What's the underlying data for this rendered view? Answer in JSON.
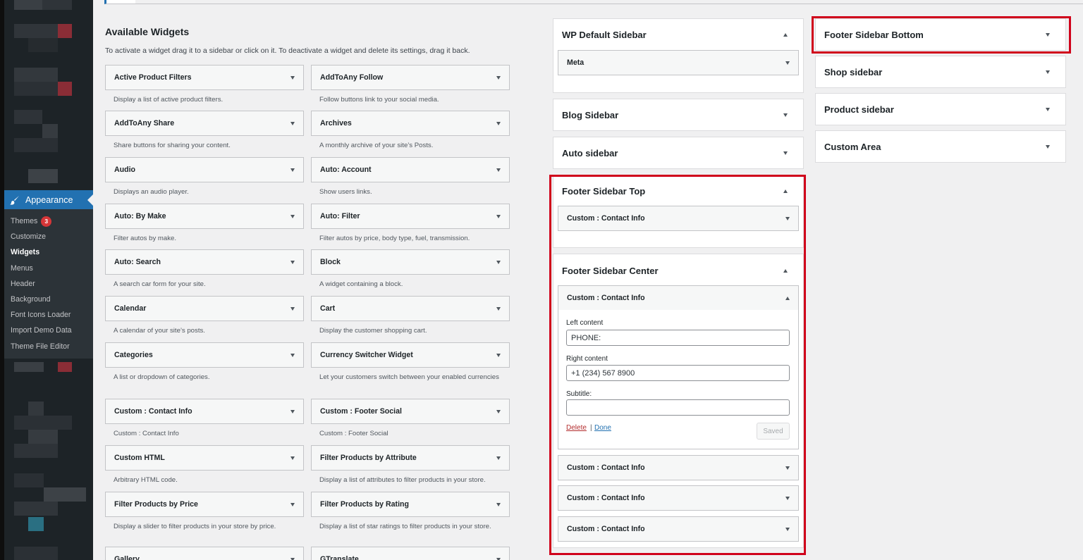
{
  "admin_menu": {
    "appearance_label": "Appearance",
    "submenu": [
      {
        "label": "Themes",
        "badge": "3"
      },
      {
        "label": "Customize"
      },
      {
        "label": "Widgets",
        "current": true
      },
      {
        "label": "Menus"
      },
      {
        "label": "Header"
      },
      {
        "label": "Background"
      },
      {
        "label": "Font Icons Loader"
      },
      {
        "label": "Import Demo Data"
      },
      {
        "label": "Theme File Editor"
      }
    ]
  },
  "available": {
    "title": "Available Widgets",
    "description": "To activate a widget drag it to a sidebar or click on it. To deactivate a widget and delete its settings, drag it back.",
    "widgets": [
      {
        "title": "Active Product Filters",
        "desc": "Display a list of active product filters."
      },
      {
        "title": "AddToAny Follow",
        "desc": "Follow buttons link to your social media."
      },
      {
        "title": "AddToAny Share",
        "desc": "Share buttons for sharing your content."
      },
      {
        "title": "Archives",
        "desc": "A monthly archive of your site’s Posts."
      },
      {
        "title": "Audio",
        "desc": "Displays an audio player."
      },
      {
        "title": "Auto: Account",
        "desc": "Show users links."
      },
      {
        "title": "Auto: By Make",
        "desc": "Filter autos by make."
      },
      {
        "title": "Auto: Filter",
        "desc": "Filter autos by price, body type, fuel, transmission."
      },
      {
        "title": "Auto: Search",
        "desc": "A search car form for your site."
      },
      {
        "title": "Block",
        "desc": "A widget containing a block."
      },
      {
        "title": "Calendar",
        "desc": "A calendar of your site’s posts."
      },
      {
        "title": "Cart",
        "desc": "Display the customer shopping cart."
      },
      {
        "title": "Categories",
        "desc": "A list or dropdown of categories."
      },
      {
        "title": "Currency Switcher Widget",
        "desc": "Let your customers switch between your enabled currencies"
      },
      {
        "title": "Custom : Contact Info",
        "desc": "Custom : Contact Info"
      },
      {
        "title": "Custom : Footer Social",
        "desc": "Custom : Footer Social"
      },
      {
        "title": "Custom HTML",
        "desc": "Arbitrary HTML code."
      },
      {
        "title": "Filter Products by Attribute",
        "desc": "Display a list of attributes to filter products in your store."
      },
      {
        "title": "Filter Products by Price",
        "desc": "Display a slider to filter products in your store by price."
      },
      {
        "title": "Filter Products by Rating",
        "desc": "Display a list of star ratings to filter products in your store."
      },
      {
        "title": "Gallery",
        "desc": ""
      },
      {
        "title": "GTranslate",
        "desc": ""
      }
    ]
  },
  "sidebars": {
    "wp_default": {
      "title": "WP Default Sidebar",
      "widgets": [
        "Meta"
      ]
    },
    "blog": {
      "title": "Blog Sidebar"
    },
    "auto": {
      "title": "Auto sidebar"
    },
    "footer_top": {
      "title": "Footer Sidebar Top",
      "widgets": [
        "Custom : Contact Info"
      ]
    },
    "footer_center": {
      "title": "Footer Sidebar Center",
      "open_widget": {
        "title": "Custom : Contact Info",
        "left_label": "Left content",
        "left_value": "PHONE:",
        "right_label": "Right content",
        "right_value": "+1 (234) 567 8900",
        "subtitle_label": "Subtitle:",
        "subtitle_value": "",
        "delete_label": "Delete",
        "separator": "|",
        "done_label": "Done",
        "saved_label": "Saved"
      },
      "widgets": [
        "Custom : Contact Info",
        "Custom : Contact Info",
        "Custom : Contact Info"
      ]
    },
    "footer_bottom": {
      "title": "Footer Sidebar Bottom"
    },
    "shop": {
      "title": "Shop sidebar"
    },
    "product": {
      "title": "Product sidebar"
    },
    "custom_area": {
      "title": "Custom Area"
    }
  },
  "colors": {
    "admin_bg": "#1d2327",
    "accent": "#2271b1",
    "highlight_box": "#d0021b",
    "badge": "#d63638"
  }
}
